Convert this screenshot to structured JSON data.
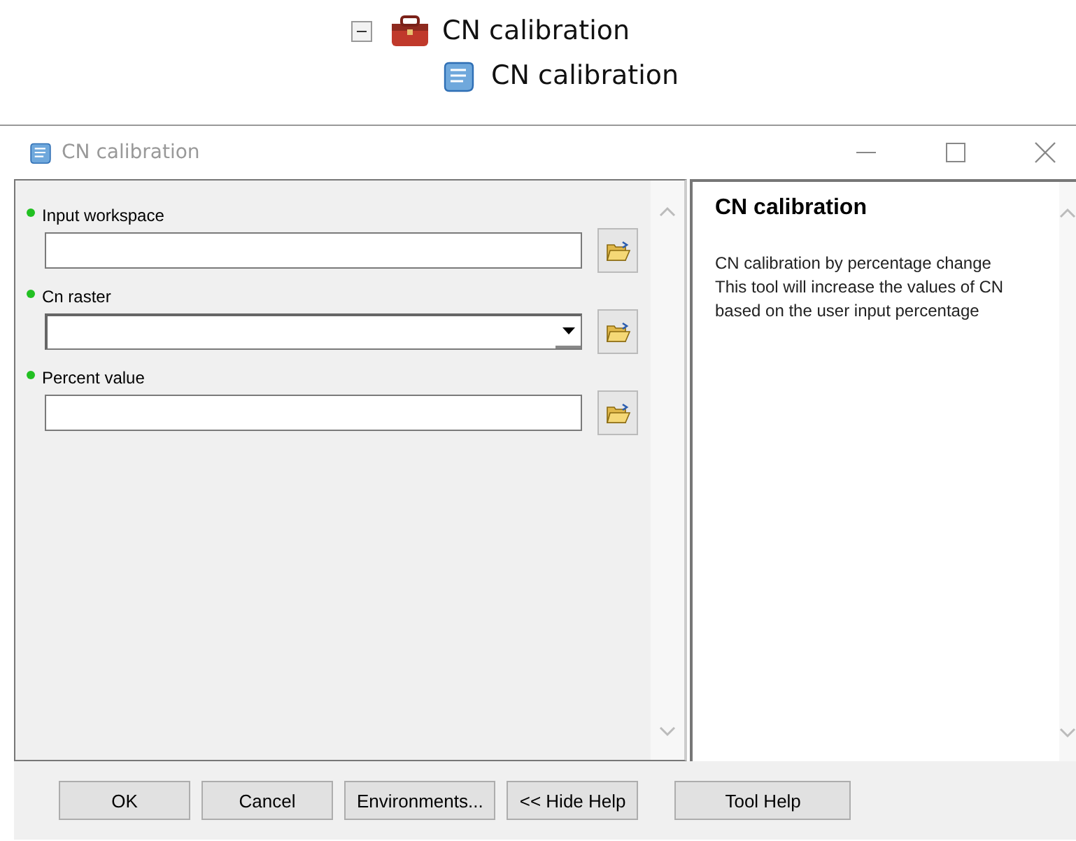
{
  "tree": {
    "parent": {
      "label": "CN calibration",
      "expanded": true
    },
    "child": {
      "label": "CN calibration"
    }
  },
  "window": {
    "title": "CN calibration"
  },
  "parameters": [
    {
      "label": "Input workspace",
      "kind": "text"
    },
    {
      "label": "Cn raster",
      "kind": "dropdown"
    },
    {
      "label": "Percent value",
      "kind": "text"
    }
  ],
  "help": {
    "title": "CN calibration",
    "lines": [
      "CN calibration by percentage change",
      "This tool will increase the values of CN",
      "based on the user input percentage"
    ]
  },
  "buttons": [
    {
      "label": "OK",
      "kind": "left"
    },
    {
      "label": "Cancel",
      "kind": "left"
    },
    {
      "label": "Environments...",
      "kind": "left"
    },
    {
      "label": "<< Hide Help",
      "kind": "left"
    },
    {
      "label": "Tool Help",
      "kind": "right"
    }
  ]
}
